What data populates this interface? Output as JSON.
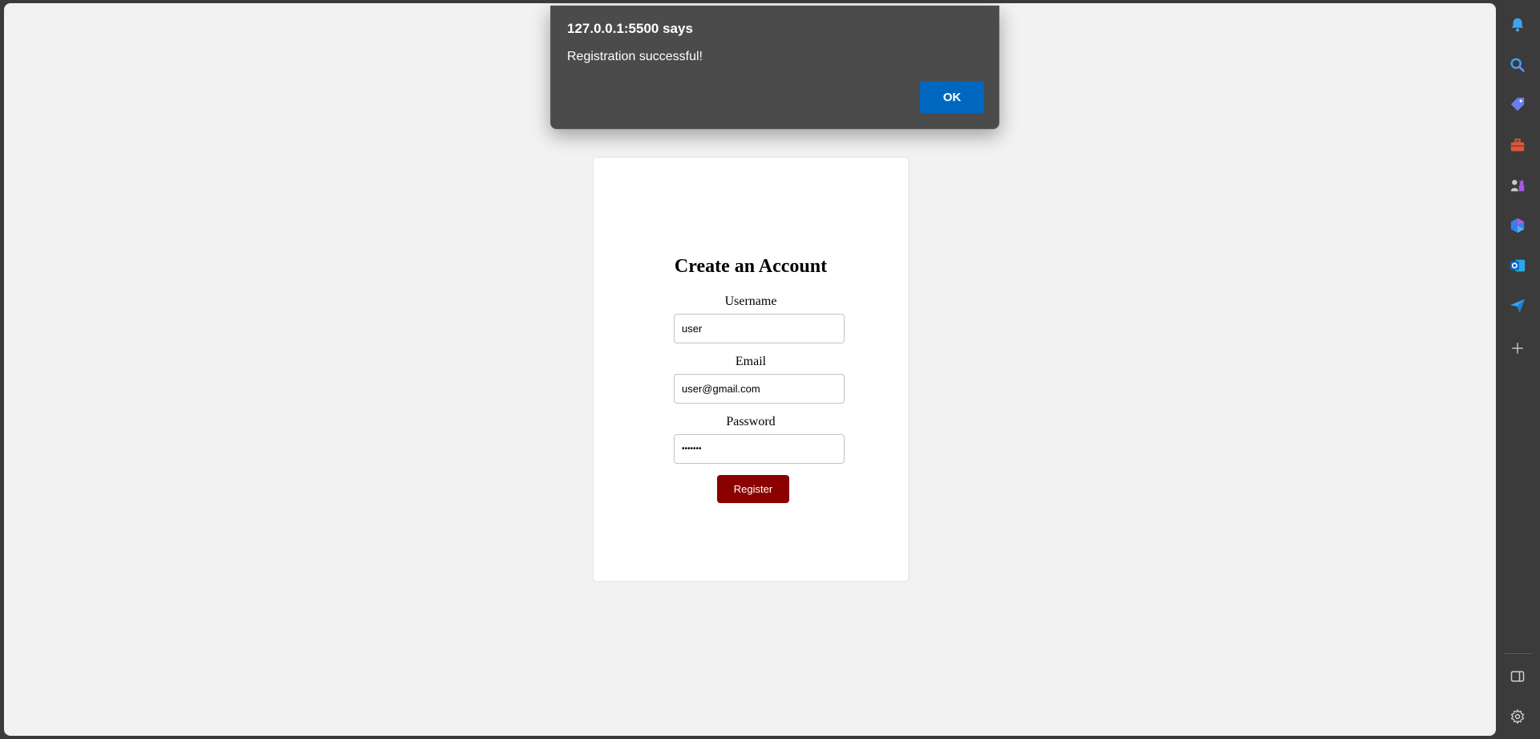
{
  "dialog": {
    "title": "127.0.0.1:5500 says",
    "message": "Registration successful!",
    "ok_label": "OK"
  },
  "form": {
    "title": "Create an Account",
    "username_label": "Username",
    "username_value": "user",
    "email_label": "Email",
    "email_value": "user@gmail.com",
    "password_label": "Password",
    "password_value": "1234567",
    "register_label": "Register"
  },
  "sidebar": {
    "icons": [
      "bell-icon",
      "search-icon",
      "tag-icon",
      "toolbox-icon",
      "chess-icon",
      "copilot-icon",
      "outlook-icon",
      "send-icon",
      "add-icon",
      "sidebar-toggle-icon",
      "settings-icon"
    ]
  },
  "colors": {
    "register_button": "#8b0000",
    "dialog_ok": "#0067c0",
    "page_background": "#f2f2f2"
  }
}
